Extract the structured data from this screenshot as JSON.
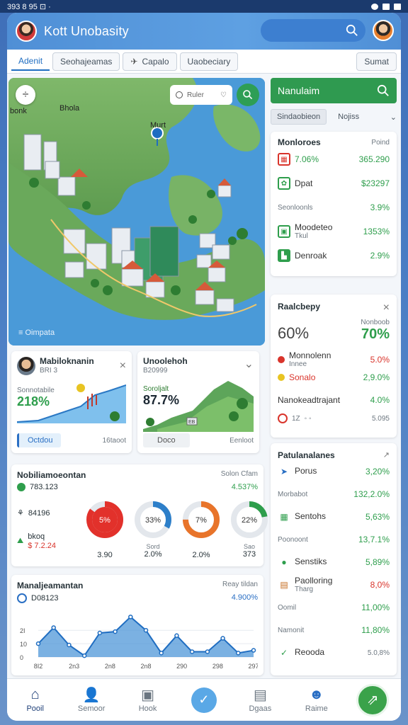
{
  "status_bar": {
    "time": "393 8 95 ⊡ ·"
  },
  "header": {
    "title": "Kott Unobasity"
  },
  "tabs": [
    {
      "label": "Adenit",
      "active": true
    },
    {
      "label": "Seohajeamas",
      "active": false
    },
    {
      "label": "Capalo",
      "active": false
    },
    {
      "label": "Uaobeciary",
      "active": false
    },
    {
      "label": "Sumat",
      "active": false
    }
  ],
  "map": {
    "search_placeholder": "Ruler",
    "labels": {
      "a": "bonk",
      "b": "Bhola",
      "c": "Murt"
    },
    "caption": "Oimpata"
  },
  "right_panel": {
    "nav_title": "Nanulaim",
    "subtab_active": "Sindaobieon",
    "subtab_other": "Nojiss",
    "metrics_card": {
      "title": "Monloroes",
      "title_right": "Poind",
      "rows": [
        {
          "label": "7.06%",
          "value": "365.290",
          "value_color": "green",
          "icon": "chart-icon"
        },
        {
          "label": "Dpat",
          "value": "$23297",
          "value_color": "green",
          "icon": "leaf-icon"
        },
        {
          "label": "Seonloonls",
          "value": "3.9%",
          "value_color": "green",
          "icon": ""
        },
        {
          "label": "Moodeteo",
          "sub": "Tkul",
          "value": "1353%",
          "value_color": "green",
          "icon": "grid-icon"
        },
        {
          "label": "Denroak",
          "value": "2.9%",
          "value_color": "green",
          "icon": "building-icon"
        }
      ]
    },
    "risk_card": {
      "title": "Raalcbepy",
      "pct_left": "60%",
      "pct_right": "70%",
      "pct_right_label": "Nonboob",
      "rows": [
        {
          "label": "Monnolenn",
          "sub": "Innee",
          "value": "5.0%",
          "color": "red"
        },
        {
          "label": "Sonalo",
          "value": "2,9.0%",
          "color": "green"
        },
        {
          "label": "Nanokeadtrajant",
          "value": "4.0%",
          "color": "green"
        },
        {
          "label": "1Z",
          "value": "5.095",
          "color": "green"
        }
      ]
    },
    "perf_card": {
      "title": "Patulanalanes",
      "rows": [
        {
          "label": "Porus",
          "value": "3,20%",
          "color": "green",
          "icon": "pin-icon"
        },
        {
          "label": "Morbabot",
          "value": "132,2.0%",
          "color": "green",
          "icon": ""
        },
        {
          "label": "Sentohs",
          "value": "5,63%",
          "color": "green",
          "icon": "table-icon"
        },
        {
          "label": "Poonoont",
          "value": "13,7.1%",
          "color": "green",
          "icon": ""
        },
        {
          "label": "Senstiks",
          "value": "5,89%",
          "color": "green",
          "icon": "dot-icon"
        },
        {
          "label": "Paolloring",
          "sub": "Tharg",
          "value": "8,0%",
          "color": "red",
          "icon": "doc-icon"
        },
        {
          "label": "Oomil",
          "value": "11,00%",
          "color": "green",
          "icon": ""
        },
        {
          "label": "Namonit",
          "value": "11,80%",
          "color": "green",
          "icon": ""
        },
        {
          "label": "Reooda",
          "value": "5.0,8%",
          "color": "gray",
          "icon": "check-icon"
        }
      ]
    }
  },
  "card_a": {
    "title": "Mabiloknanin",
    "sub": "BRI 3",
    "label": "Sonnotabile",
    "value": "218%",
    "btn_primary": "Octdou",
    "btn_secondary": "16taoot"
  },
  "card_b": {
    "title": "Unoolehoh",
    "sub": "B20999",
    "label": "Soroljalt",
    "value": "87.7%",
    "tag": "EB",
    "btn_primary": "Doco",
    "btn_secondary": "Eenloot"
  },
  "donut_card": {
    "title": "Nobiliamoeontan",
    "title_right": "Solon Cfam",
    "left_value": "783.123",
    "left_right_value": "4.537%",
    "item1": "84196",
    "item2_label": "bkoq",
    "item2_value": "$ 7.2.24",
    "donuts": [
      {
        "center": "5%",
        "value": 0.85,
        "color": "#e2312b",
        "bottom_label": "",
        "bottom_value": "3.90"
      },
      {
        "center": "33%",
        "value": 0.33,
        "color": "#2d7fc9",
        "bottom_label": "Sord",
        "bottom_value": "2.0%"
      },
      {
        "center": "7%",
        "value": 0.75,
        "color": "#e8742a",
        "bottom_label": "",
        "bottom_value": "2.0%"
      },
      {
        "center": "22%",
        "value": 0.22,
        "color": "#2e9e4c",
        "bottom_label": "Sao",
        "bottom_value": "373"
      }
    ]
  },
  "bottom_chart_card": {
    "title": "Manaljeamantan",
    "title_right": "Reay tildan",
    "left_value": "D08123",
    "right_value": "4.900%"
  },
  "chart_data": {
    "type": "area",
    "x": [
      "8I2",
      "2n3",
      "2n8",
      "2n8",
      "290",
      "298",
      "297"
    ],
    "xticks": [
      "8I2",
      "2n3",
      "2n8",
      "2n8",
      "290",
      "298",
      "297"
    ],
    "yticks": [
      "0",
      "10",
      "2I"
    ],
    "series": [
      {
        "values": [
          10,
          22,
          9,
          1,
          18,
          19,
          30,
          20,
          3,
          16,
          4,
          4,
          14,
          3,
          5
        ]
      }
    ],
    "ylim": [
      0,
      36
    ]
  },
  "bottom_nav": [
    {
      "label": "Pooil",
      "icon": "home-icon",
      "active": true
    },
    {
      "label": "Semoor",
      "icon": "user-icon",
      "active": false
    },
    {
      "label": "Hook",
      "icon": "book-icon",
      "active": false
    },
    {
      "label": "",
      "icon": "check-icon",
      "active": false,
      "fab": true
    },
    {
      "label": "Dgaas",
      "icon": "chat-icon",
      "active": false
    },
    {
      "label": "Raime",
      "icon": "group-icon",
      "active": false
    },
    {
      "label": "",
      "icon": "plus-icon",
      "active": false,
      "fab_green": true
    }
  ]
}
